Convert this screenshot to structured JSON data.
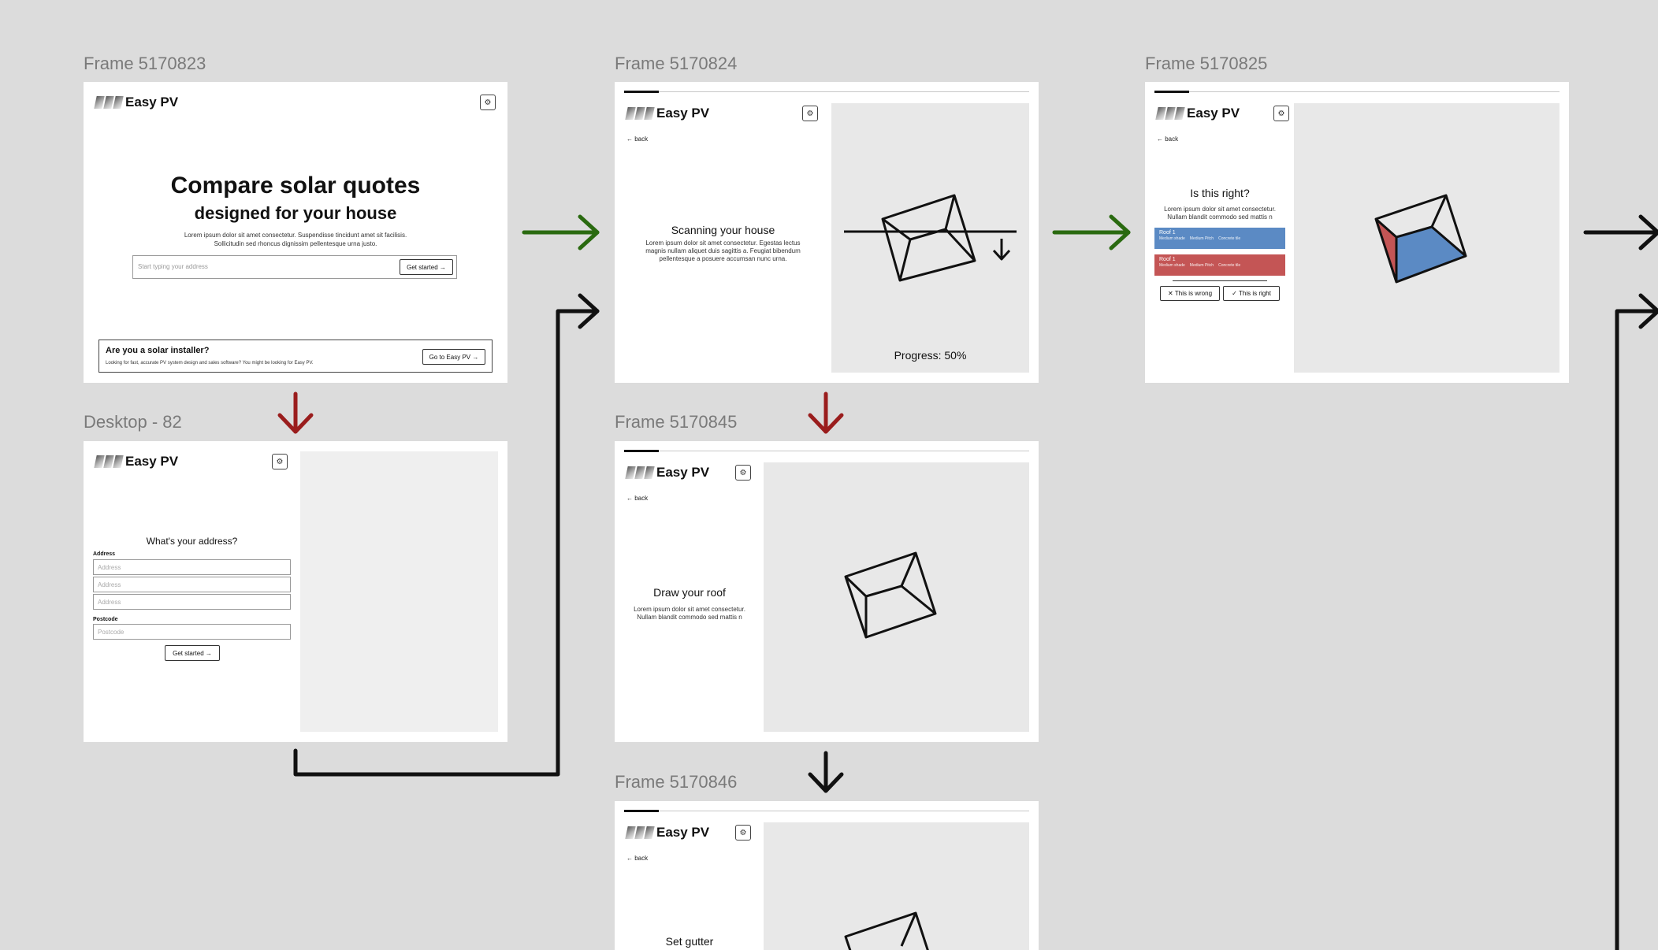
{
  "labels": {
    "f823": "Frame 5170823",
    "f824": "Frame 5170824",
    "f825": "Frame 5170825",
    "d82": "Desktop - 82",
    "f845": "Frame 5170845",
    "f846": "Frame 5170846"
  },
  "brand": "Easy PV",
  "back": "back",
  "landing": {
    "title1": "Compare solar quotes",
    "title2": "designed for your house",
    "desc1": "Lorem ipsum dolor sit amet consectetur. Suspendisse tincidunt amet sit facilisis.",
    "desc2": "Sollicitudin sed rhoncus dignissim pellentesque urna justo.",
    "search_placeholder": "Start typing your address",
    "get_started": "Get started",
    "installer_title": "Are you a solar installer?",
    "installer_desc": "Looking for fast, accurate PV system design and sales software? You might be looking for Easy PV.",
    "go_easy": "Go to Easy PV"
  },
  "address": {
    "title": "What's your address?",
    "address_label": "Address",
    "address_placeholder": "Address",
    "postcode_label": "Postcode",
    "postcode_placeholder": "Postcode",
    "get_started": "Get started"
  },
  "scanning": {
    "title": "Scanning your house",
    "desc1": "Lorem ipsum dolor sit amet consectetur. Egestas lectus",
    "desc2": "magnis nullam aliquet duis sagittis a. Feugiat bibendum",
    "desc3": "pellentesque a posuere accumsan nunc urna.",
    "progress": "Progress: 50%",
    "progress_value": 0.5
  },
  "confirm": {
    "title": "Is this right?",
    "desc1": "Lorem ipsum dolor sit amet consectetur.",
    "desc2": "Nullam blandit commodo sed mattis n",
    "roof1_name": "Roof 1",
    "roof2_name": "Roof 1",
    "tag1": "Medium shade",
    "tag2": "Medium Pitch",
    "tag3": "Concrete tile",
    "wrong": "This is wrong",
    "right": "This is right"
  },
  "draw": {
    "title": "Draw your roof",
    "desc1": "Lorem ipsum dolor sit amet consectetur.",
    "desc2": "Nullam blandit commodo sed mattis n"
  },
  "gutter": {
    "title": "Set gutter"
  },
  "colors": {
    "green_arrow": "#2a6a10",
    "red_arrow": "#9a1d1d",
    "roof_blue": "#5b8ac4",
    "roof_red": "#c45555"
  }
}
